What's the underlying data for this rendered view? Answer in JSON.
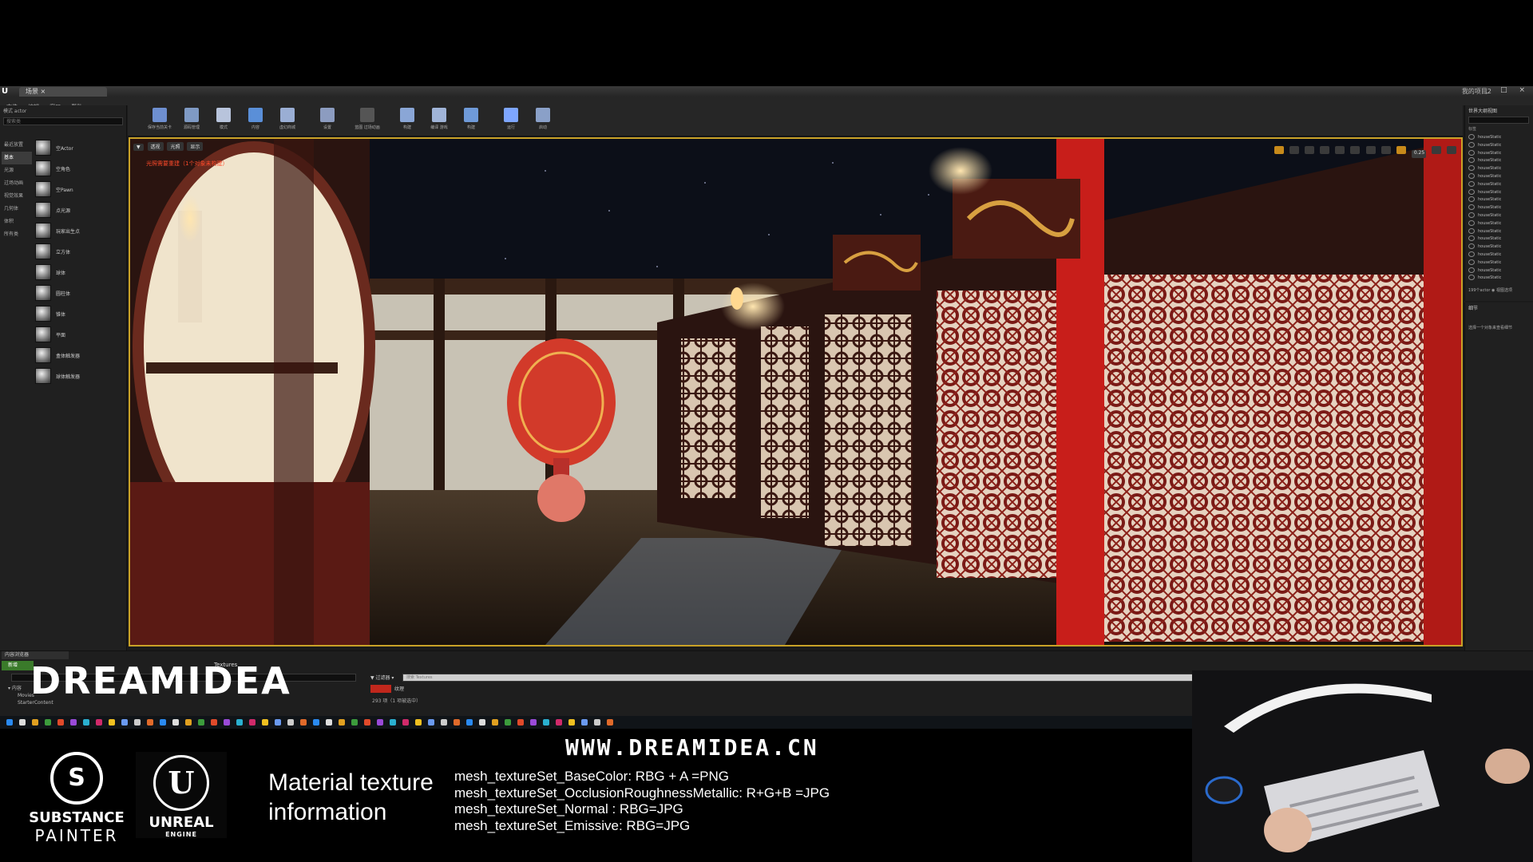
{
  "editor": {
    "level_tab": "场景 ×",
    "project_name": "我的项目2",
    "window_controls": "_ □ ×",
    "menus": [
      "文件",
      "编辑",
      "窗口",
      "帮助"
    ]
  },
  "modes": {
    "header": "模式 actor",
    "search_placeholder": "搜索类",
    "categories": [
      "最近放置",
      "基本",
      "光源",
      "过场动画",
      "视觉效果",
      "几何体",
      "体积",
      "所有类"
    ],
    "active_category": "基本",
    "items": [
      "空Actor",
      "空角色",
      "空Pawn",
      "点光源",
      "玩家出生点",
      "立方体",
      "球体",
      "圆柱体",
      "锥体",
      "平面",
      "盒体触发器",
      "球体触发器"
    ]
  },
  "toolbar": {
    "buttons": [
      {
        "label": "保存当前关卡",
        "icon": "save-icon",
        "color": "#6e8fd0"
      },
      {
        "label": "源码管理",
        "icon": "source-control-icon",
        "color": "#7f9ac4"
      },
      {
        "label": "模式",
        "icon": "modes-icon",
        "color": "#b8c4dc"
      },
      {
        "label": "内容",
        "icon": "content-icon",
        "color": "#5a8fd8"
      },
      {
        "label": "虚幻商城",
        "icon": "marketplace-icon",
        "color": "#9aaed4"
      },
      {
        "label": "设置",
        "icon": "settings-icon",
        "color": "#8c9cc0"
      },
      {
        "label": "蓝图 过场动画",
        "icon": "blueprint-icon",
        "color": "#555"
      },
      {
        "label": "构建",
        "icon": "build-icon",
        "color": "#8aa6d6"
      },
      {
        "label": "编译 游戏",
        "icon": "compile-icon",
        "color": "#a0b4d8"
      },
      {
        "label": "构建",
        "icon": "cook-icon",
        "color": "#6f9ad8"
      },
      {
        "label": "运行",
        "icon": "play-icon",
        "color": "#7ea6ff"
      },
      {
        "label": "启动",
        "icon": "launch-icon",
        "color": "#8aa0c8"
      }
    ]
  },
  "viewport": {
    "controls": [
      "▼",
      "透视",
      "光照",
      "显示"
    ],
    "warning": "光照需要重建（1个对象未构建）",
    "grid_scale": "0.25",
    "border_color": "#c9a227"
  },
  "outliner": {
    "title": "世界大纲视图",
    "column_label": "标签",
    "rows": [
      "houseStatic",
      "houseStatic",
      "houseStatic",
      "houseStatic",
      "houseStatic",
      "houseStatic",
      "houseStatic",
      "houseStatic",
      "houseStatic",
      "houseStatic",
      "houseStatic",
      "houseStatic",
      "houseStatic",
      "houseStatic",
      "houseStatic",
      "houseStatic",
      "houseStatic",
      "houseStatic",
      "houseStatic"
    ],
    "footer": "199个actor ◉ 视图选项"
  },
  "details": {
    "title": "细节",
    "message": "选择一个对象来查看细节"
  },
  "content_browser": {
    "tab": "内容浏览器",
    "add_button": "新增",
    "path": "Textures",
    "tree": [
      "▾ 内容",
      "Movies",
      "StarterContent"
    ],
    "filters_label": "▼ 过滤器 ▾",
    "search_placeholder": "搜索 Textures",
    "asset_label": "纹理",
    "item_count": "293 项（1 项被选中）",
    "asset_color": "#c0271c"
  },
  "overlay": {
    "brand_logo": "DREAMIDEA",
    "website": "WWW.DREAMIDEA.CN",
    "substance_mark": "S",
    "substance_line1": "SUBSTANCE",
    "substance_line2": "PAINTER",
    "unreal_mark": "U",
    "unreal_line1": "UNREAL",
    "unreal_line2": "ENGINE",
    "material_title_line1": "Material texture",
    "material_title_line2": "information",
    "material_lines": [
      "mesh_textureSet_BaseColor: RBG + A  =PNG",
      "mesh_textureSet_OcclusionRoughnessMetallic:  R+G+B  =JPG",
      "mesh_textureSet_Normal : RBG=JPG",
      "mesh_textureSet_Emissive: RBG=JPG"
    ]
  }
}
